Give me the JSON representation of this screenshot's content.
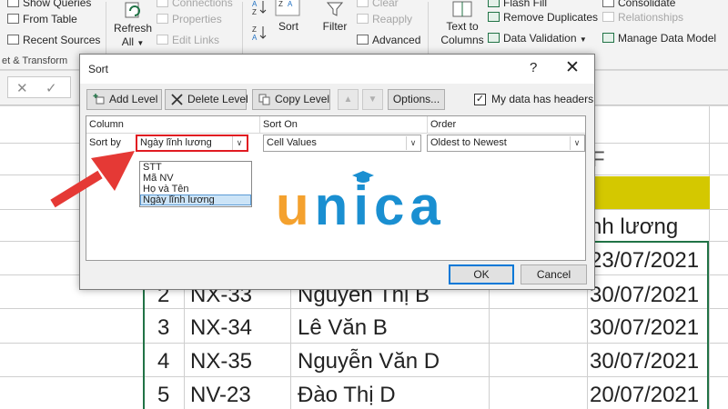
{
  "ribbon": {
    "show_queries": "Show Queries",
    "from_table": "From Table",
    "recent_sources": "Recent Sources",
    "refresh_all": "Refresh All",
    "connections": "Connections",
    "properties": "Properties",
    "edit_links": "Edit Links",
    "sort": "Sort",
    "filter": "Filter",
    "clear": "Clear",
    "reapply": "Reapply",
    "advanced": "Advanced",
    "text_to_columns": "Text to Columns",
    "flash_fill": "Flash Fill",
    "remove_duplicates": "Remove Duplicates",
    "data_validation": "Data Validation",
    "consolidate": "Consolidate",
    "relationships": "Relationships",
    "manage_data_model": "Manage Data Model",
    "group_get_transform": "et & Transform"
  },
  "sheet": {
    "column_f": "F",
    "header_tail": "nh lương",
    "rows": [
      {
        "num": "",
        "code": "",
        "name": "",
        "date": "23/07/2021"
      },
      {
        "num": "2",
        "code": "NX-33",
        "name": "Nguyễn Thị B",
        "date": "30/07/2021"
      },
      {
        "num": "3",
        "code": "NX-34",
        "name": "Lê Văn B",
        "date": "30/07/2021"
      },
      {
        "num": "4",
        "code": "NX-35",
        "name": "Nguyễn Văn D",
        "date": "30/07/2021"
      },
      {
        "num": "5",
        "code": "NV-23",
        "name": "Đào Thị D",
        "date": "20/07/2021"
      }
    ]
  },
  "dialog": {
    "title": "Sort",
    "help": "?",
    "close": "✕",
    "add_level": "Add Level",
    "delete_level": "Delete Level",
    "copy_level": "Copy Level",
    "options": "Options...",
    "my_data_has_headers": "My data has headers",
    "headers_checked": true,
    "col_header": "Column",
    "sorton_header": "Sort On",
    "order_header": "Order",
    "sort_by": "Sort by",
    "column_value": "Ngày lĩnh lương",
    "sorton_value": "Cell Values",
    "order_value": "Oldest to Newest",
    "dropdown_options": [
      "STT",
      "Mã NV",
      "Họ và Tên",
      "Ngày lĩnh lương"
    ],
    "selected_option": "Ngày lĩnh lương",
    "ok": "OK",
    "cancel": "Cancel"
  },
  "watermark": {
    "letters": [
      "u",
      "n",
      "i",
      "c",
      "a"
    ],
    "colors": {
      "u": "#f4a12e",
      "rest": "#1a8fd1"
    }
  },
  "colors": {
    "highlight_red": "#e11b22",
    "arrow_red": "#e53935",
    "excel_green": "#217346",
    "header_yellow": "#d4c800"
  }
}
